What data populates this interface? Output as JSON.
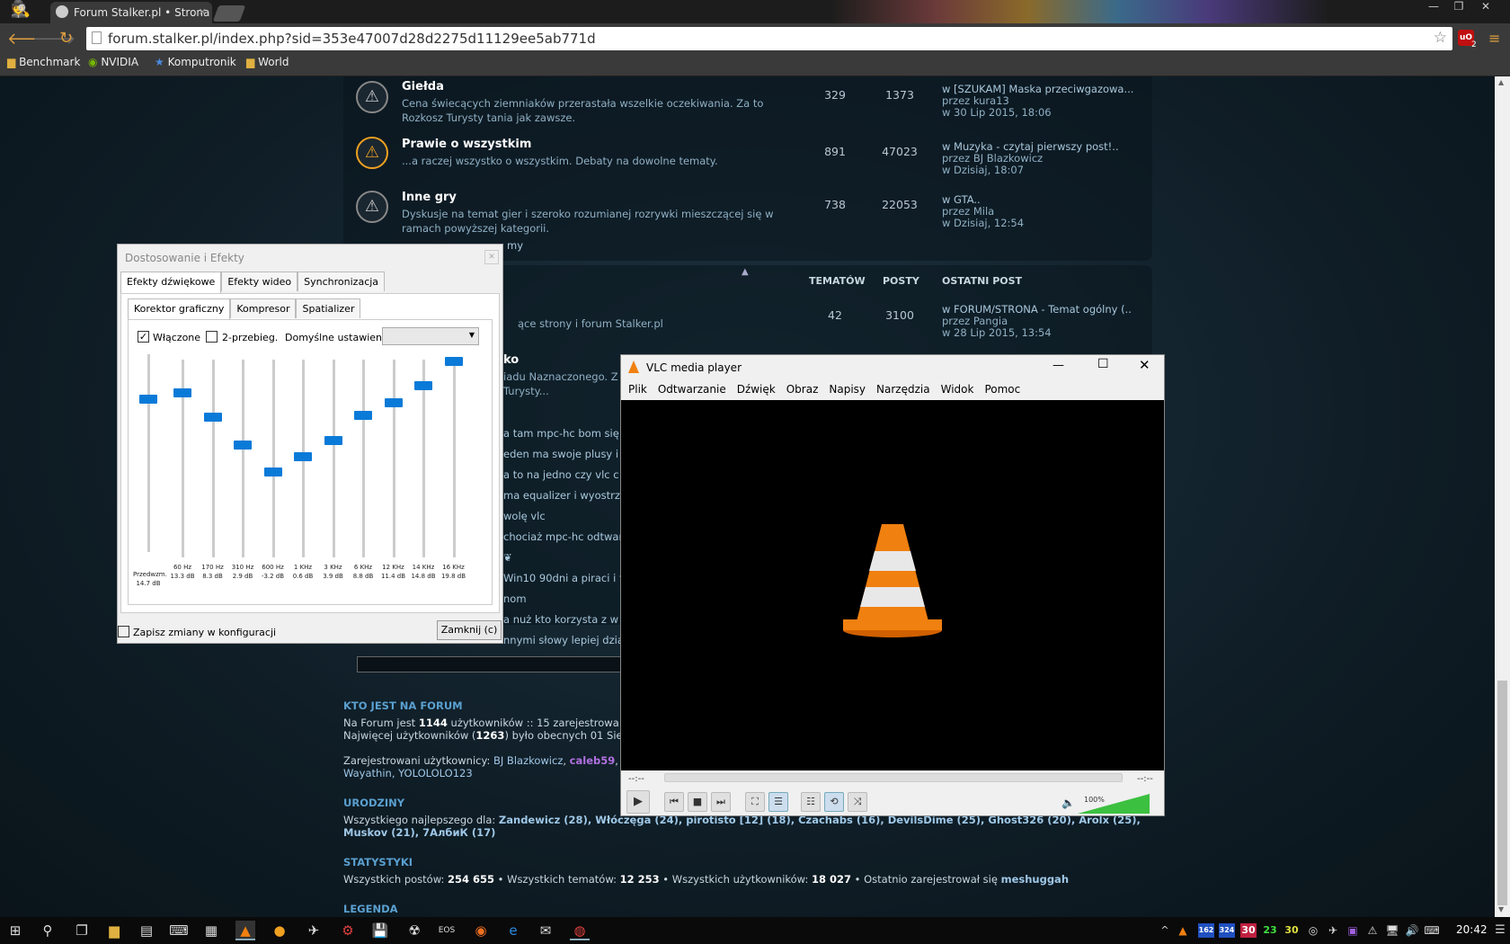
{
  "browser": {
    "tab_title": "Forum Stalker.pl • Strona g",
    "url": "forum.stalker.pl/index.php?sid=353e47007d28d2275d11129ee5ab771d",
    "bookmarks": [
      "Benchmark",
      "NVIDIA",
      "Komputronik",
      "World"
    ],
    "extension_badge": "2"
  },
  "forums": [
    {
      "name": "Giełda",
      "desc": "Cena świecących ziemniaków przerastała wszelkie oczekiwania. Za to Rozkosz Turysty tania jak zawsze.",
      "topics": "329",
      "posts": "1373",
      "last_topic": "w [SZUKAM] Maska przeciwgazowa...",
      "last_by": "przez kura13",
      "last_date": "w 30 Lip 2015, 18:06"
    },
    {
      "name": "Prawie o wszystkim",
      "desc": "...a raczej wszystko o wszystkim. Debaty na dowolne tematy.",
      "topics": "891",
      "posts": "47023",
      "last_topic": "w Muzyka - czytaj pierwszy post!..",
      "last_by": "przez BJ Blazkowicz",
      "last_date": "w Dzisiaj, 18:07"
    },
    {
      "name": "Inne gry",
      "desc": "Dyskusje na temat gier i szeroko rozumianej rozrywki mieszczącej się w ramach powyższej kategorii.",
      "topics": "738",
      "posts": "22053",
      "last_topic": "w GTA..",
      "last_by": "przez Mila",
      "last_date": "w Dzisiaj, 12:54"
    }
  ],
  "forum_partial_tail": "my",
  "headers": {
    "topics": "TEMATÓW",
    "posts": "POSTY",
    "last": "OSTATNI POST"
  },
  "section2": {
    "desc_frag": "ące strony i forum Stalker.pl",
    "topics": "42",
    "posts": "3100",
    "last_topic": "w FORUM/STRONA - Temat ogólny (..",
    "last_by": "przez Pangia",
    "last_date": "w 28 Lip 2015, 13:54"
  },
  "section3": {
    "title_frag": "ko",
    "line1": "iadu Naznaczonego. Z",
    "line2": "Turysty..."
  },
  "recent_posts": [
    "a tam mpc-hc bom się",
    "eden ma swoje plusy i",
    "a to na jedno czy vlc c",
    "ma equalizer i wyostrza",
    "wolę vlc",
    "chociaż mpc-hc odtwar",
    "",
    "Win10 90dni a piraci i t",
    "nom",
    "a nuż kto korzysta z w",
    "nnymi słowy lepiej dzia"
  ],
  "who": {
    "title": "KTO JEST NA FORUM",
    "line1_pre": "Na Forum jest ",
    "line1_num": "1144",
    "line1_post": " użytkowników :: 15 zarejestrowa",
    "line2_pre": "Najwięcej użytkowników (",
    "line2_num": "1263",
    "line2_post": ") było obecnych 01 Sie",
    "line3_pre": "Zarejestrowani użytkownicy: ",
    "line3_u1": "BJ Blazkowicz",
    "line3_u2": "caleb59",
    "line4": "Wayathin, YOLOLOLO123"
  },
  "birthdays": {
    "title": "URODZINY",
    "pre": "Wszystkiego najlepszego dla: ",
    "line1": "Zandewicz (28), Włóczęga (24), pirotisto [12] (18), Czachabs (16), DevilsDime (25), Ghost326 (20), Arolx (25),",
    "line2": "Muskov (21), 7АлбиК (17)"
  },
  "stats": {
    "title": "STATYSTYKI",
    "pre": "Wszystkich postów: ",
    "posts": "254 655",
    "mid1": " • Wszystkich tematów: ",
    "topics": "12 253",
    "mid2": " • Wszystkich użytkowników: ",
    "users": "18 027",
    "mid3": " • Ostatnio zarejestrował się ",
    "newest": "meshuggah"
  },
  "legend": "LEGENDA",
  "dialog": {
    "title": "Dostosowanie i Efekty",
    "tabs": [
      "Efekty dźwiękowe",
      "Efekty wideo",
      "Synchronizacja"
    ],
    "subtabs": [
      "Korektor graficzny",
      "Kompresor",
      "Spatializer"
    ],
    "enabled_label": "Włączone",
    "twopass_label": "2-przebieg.",
    "preset_label": "Domyślne ustawienie",
    "preset_value": "",
    "preamp": {
      "name": "Przedwzm.",
      "gain": "14.7 dB",
      "level": 0.8
    },
    "bands": [
      {
        "freq": "60 Hz",
        "gain": "13.3 dB",
        "level": 0.83
      },
      {
        "freq": "170 Hz",
        "gain": "8.3 dB",
        "level": 0.71
      },
      {
        "freq": "310 Hz",
        "gain": "2.9 dB",
        "level": 0.57
      },
      {
        "freq": "600 Hz",
        "gain": "-3.2 dB",
        "level": 0.43
      },
      {
        "freq": "1 KHz",
        "gain": "0.6 dB",
        "level": 0.51
      },
      {
        "freq": "3 KHz",
        "gain": "3.9 dB",
        "level": 0.59
      },
      {
        "freq": "6 KHz",
        "gain": "8.8 dB",
        "level": 0.72
      },
      {
        "freq": "12 KHz",
        "gain": "11.4 dB",
        "level": 0.78
      },
      {
        "freq": "14 KHz",
        "gain": "14.8 dB",
        "level": 0.87
      },
      {
        "freq": "16 KHz",
        "gain": "19.8 dB",
        "level": 0.99
      }
    ],
    "save_label": "Zapisz zmiany w konfiguracji",
    "close_label": "Zamknij (c)"
  },
  "vlc": {
    "title": "VLC media player",
    "menu": [
      "Plik",
      "Odtwarzanie",
      "Dźwięk",
      "Obraz",
      "Napisy",
      "Narzędzia",
      "Widok",
      "Pomoc"
    ],
    "time_left": "--:--",
    "time_right": "--:--",
    "volume": "100%",
    "volume_level": 1.0
  },
  "taskbar": {
    "clock": "20:42",
    "tray_numbers": [
      "162",
      "324",
      "30",
      "23",
      "30"
    ]
  },
  "colors": {
    "accent": "#0a7ad8",
    "vlc_orange": "#f08010",
    "link": "#a8c8dc"
  }
}
